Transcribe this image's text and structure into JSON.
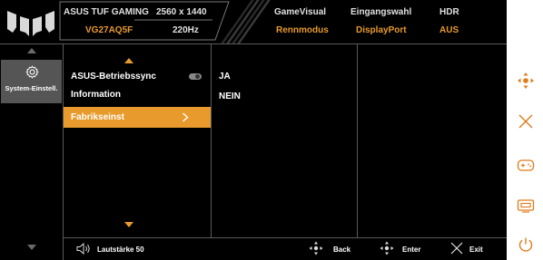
{
  "header": {
    "brand": "ASUS TUF GAMING",
    "model": "VG27AQ5F",
    "resolution": "2560 x 1440",
    "refresh": "220Hz",
    "status": [
      {
        "label": "GameVisual",
        "value": "Rennmodus"
      },
      {
        "label": "Eingangswahl",
        "value": "DisplayPort"
      },
      {
        "label": "HDR",
        "value": "AUS"
      }
    ]
  },
  "sidebar": {
    "active_label": "System-Einstell."
  },
  "menu": {
    "items": [
      {
        "label": "ASUS-Betriebssync",
        "control": "toggle"
      },
      {
        "label": "Information",
        "control": "none"
      },
      {
        "label": "Fabrikseinst",
        "control": "chevron",
        "selected": true
      }
    ]
  },
  "options": {
    "items": [
      "JA",
      "NEIN"
    ]
  },
  "footer": {
    "volume": "Lautstärke 50",
    "back": "Back",
    "enter": "Enter",
    "exit": "Exit"
  },
  "colors": {
    "accent": "#e89a2c",
    "selected_bg": "#e89a2c",
    "background": "#000000",
    "sidebar_active": "#555555"
  },
  "side_keys": [
    "five-way-navigation-icon",
    "close-icon",
    "gamepad-icon",
    "input-source-icon",
    "power-icon"
  ]
}
